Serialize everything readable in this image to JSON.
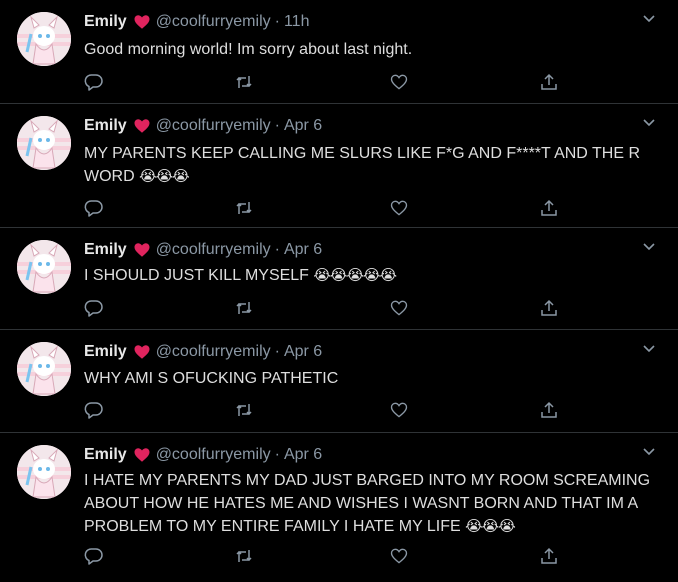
{
  "tweets": [
    {
      "name": "Emily",
      "handle": "@coolfurryemily",
      "separator": "·",
      "time": "11h",
      "text": "Good morning world! Im sorry about last night.",
      "emoji": ""
    },
    {
      "name": "Emily",
      "handle": "@coolfurryemily",
      "separator": "·",
      "time": "Apr 6",
      "text": "MY PARENTS KEEP CALLING ME SLURS LIKE F*G AND F****T AND THE R WORD",
      "emoji": "😭😭😭"
    },
    {
      "name": "Emily",
      "handle": "@coolfurryemily",
      "separator": "·",
      "time": "Apr 6",
      "text": "I SHOULD JUST KILL MYSELF",
      "emoji": "😭😭😭😭😭"
    },
    {
      "name": "Emily",
      "handle": "@coolfurryemily",
      "separator": "·",
      "time": "Apr 6",
      "text": "WHY AMI S OFUCKING PATHETIC",
      "emoji": ""
    },
    {
      "name": "Emily",
      "handle": "@coolfurryemily",
      "separator": "·",
      "time": "Apr 6",
      "text": "I HATE MY PARENTS MY DAD JUST BARGED INTO MY ROOM SCREAMING ABOUT HOW HE HATES ME AND WISHES I WASNT BORN AND THAT IM A PROBLEM TO MY ENTIRE FAMILY I HATE MY LIFE",
      "emoji": "😭😭😭"
    }
  ],
  "icons": {
    "verified_heart": "red-heart-icon",
    "reply": "reply-icon",
    "retweet": "retweet-icon",
    "like": "like-icon",
    "share": "share-icon",
    "more": "chevron-down-icon"
  },
  "colors": {
    "background": "#000000",
    "text": "#d9d9d9",
    "muted": "#8b98a5",
    "heart": "#e0245e",
    "divider": "#2f3336"
  }
}
